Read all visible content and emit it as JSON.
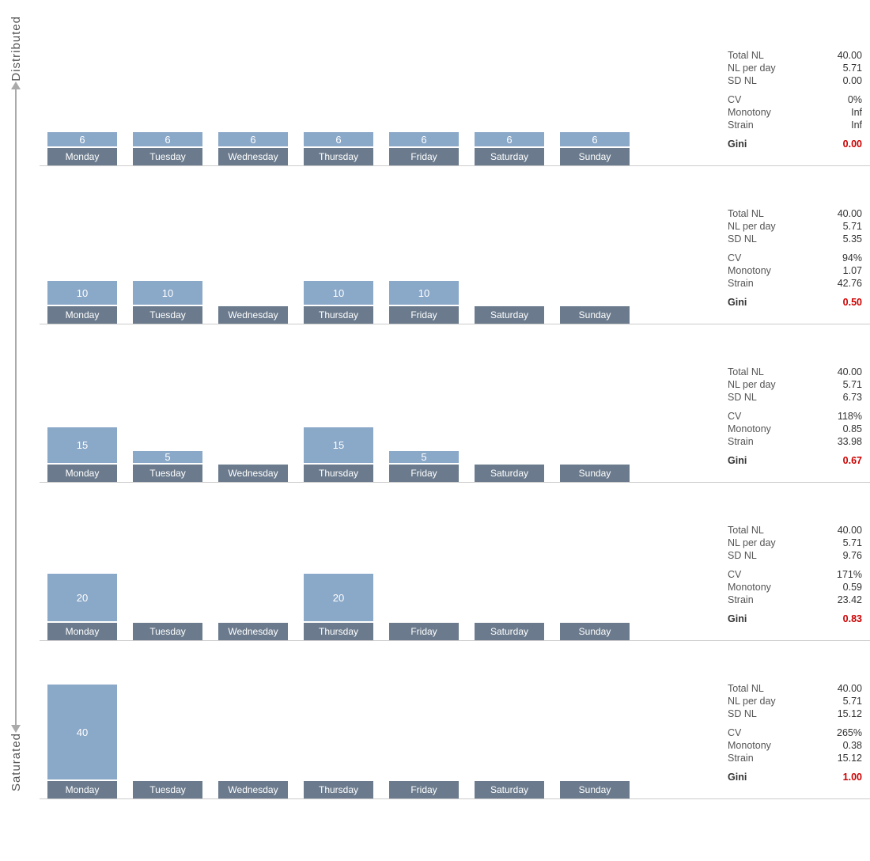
{
  "leftLabel": {
    "distributed": "Distributed",
    "saturated": "Saturated"
  },
  "days": [
    "Monday",
    "Tuesday",
    "Wednesday",
    "Thursday",
    "Friday",
    "Saturday",
    "Sunday"
  ],
  "scenarios": [
    {
      "id": "s1",
      "bars": [
        6,
        6,
        6,
        6,
        6,
        6,
        6
      ],
      "stats": {
        "totalNL": "40.00",
        "nlPerDay": "5.71",
        "sdNL": "0.00",
        "cv": "0%",
        "monotony": "Inf",
        "strain": "Inf",
        "gini": "0.00"
      }
    },
    {
      "id": "s2",
      "bars": [
        10,
        10,
        0,
        10,
        10,
        0,
        0
      ],
      "stats": {
        "totalNL": "40.00",
        "nlPerDay": "5.71",
        "sdNL": "5.35",
        "cv": "94%",
        "monotony": "1.07",
        "strain": "42.76",
        "gini": "0.50"
      }
    },
    {
      "id": "s3",
      "bars": [
        15,
        5,
        0,
        15,
        5,
        0,
        0
      ],
      "stats": {
        "totalNL": "40.00",
        "nlPerDay": "5.71",
        "sdNL": "6.73",
        "cv": "118%",
        "monotony": "0.85",
        "strain": "33.98",
        "gini": "0.67"
      }
    },
    {
      "id": "s4",
      "bars": [
        20,
        0,
        0,
        20,
        0,
        0,
        0
      ],
      "stats": {
        "totalNL": "40.00",
        "nlPerDay": "5.71",
        "sdNL": "9.76",
        "cv": "171%",
        "monotony": "0.59",
        "strain": "23.42",
        "gini": "0.83"
      }
    },
    {
      "id": "s5",
      "bars": [
        40,
        0,
        0,
        0,
        0,
        0,
        0
      ],
      "stats": {
        "totalNL": "40.00",
        "nlPerDay": "5.71",
        "sdNL": "15.12",
        "cv": "265%",
        "monotony": "0.38",
        "strain": "15.12",
        "gini": "1.00"
      }
    }
  ],
  "statLabels": {
    "totalNL": "Total NL",
    "nlPerDay": "NL per day",
    "sdNL": "SD NL",
    "cv": "CV",
    "monotony": "Monotony",
    "strain": "Strain",
    "gini": "Gini"
  }
}
